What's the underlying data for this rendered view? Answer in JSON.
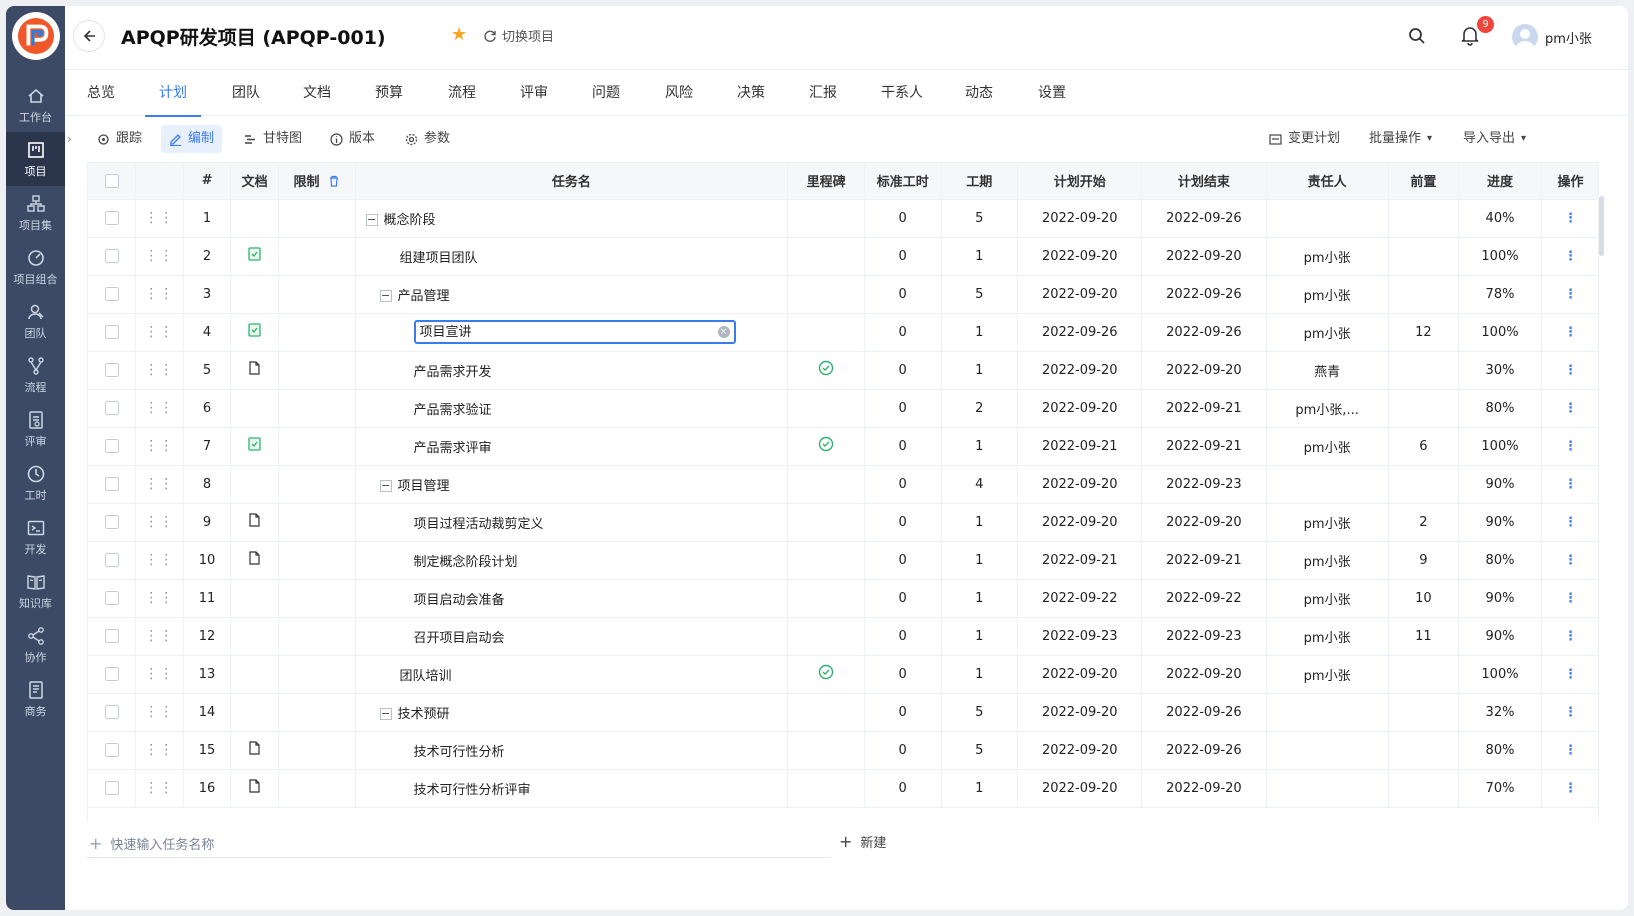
{
  "sidebar": {
    "items": [
      {
        "label": "工作台",
        "icon": "home-icon"
      },
      {
        "label": "项目",
        "icon": "project-icon"
      },
      {
        "label": "项目集",
        "icon": "program-icon"
      },
      {
        "label": "项目组合",
        "icon": "portfolio-icon"
      },
      {
        "label": "团队",
        "icon": "team-icon"
      },
      {
        "label": "流程",
        "icon": "flow-icon"
      },
      {
        "label": "评审",
        "icon": "review-icon"
      },
      {
        "label": "工时",
        "icon": "clock-icon"
      },
      {
        "label": "开发",
        "icon": "terminal-icon"
      },
      {
        "label": "知识库",
        "icon": "book-icon"
      },
      {
        "label": "协作",
        "icon": "share-icon"
      },
      {
        "label": "商务",
        "icon": "business-icon"
      }
    ],
    "active_index": 1
  },
  "header": {
    "title": "APQP研发项目 (APQP-001)",
    "switch_label": "切换项目",
    "notification_count": "9",
    "user": "pm小张"
  },
  "tabs": [
    "总览",
    "计划",
    "团队",
    "文档",
    "预算",
    "流程",
    "评审",
    "问题",
    "风险",
    "决策",
    "汇报",
    "干系人",
    "动态",
    "设置"
  ],
  "active_tab": 1,
  "toolbar": {
    "left": [
      "跟踪",
      "编制",
      "甘特图",
      "版本",
      "参数"
    ],
    "active": 1,
    "right": [
      "变更计划",
      "批量操作",
      "导入导出"
    ]
  },
  "table": {
    "columns": [
      "#",
      "文档",
      "限制",
      "任务名",
      "里程碑",
      "标准工时",
      "工期",
      "计划开始",
      "计划结束",
      "责任人",
      "前置",
      "进度",
      "操作"
    ],
    "rows": [
      {
        "no": "1",
        "doc": "",
        "task": "概念阶段",
        "level": 0,
        "toggle": true,
        "milestone": false,
        "std": "0",
        "dur": "5",
        "start": "2022-09-20",
        "end": "2022-09-26",
        "owner": "",
        "pre": "",
        "progress": "40%"
      },
      {
        "no": "2",
        "doc": "green",
        "task": "组建项目团队",
        "level": 1,
        "toggle": false,
        "milestone": false,
        "std": "0",
        "dur": "1",
        "start": "2022-09-20",
        "end": "2022-09-20",
        "owner": "pm小张",
        "pre": "",
        "progress": "100%"
      },
      {
        "no": "3",
        "doc": "",
        "task": "产品管理",
        "level": 1,
        "toggle": true,
        "milestone": false,
        "std": "0",
        "dur": "5",
        "start": "2022-09-20",
        "end": "2022-09-26",
        "owner": "pm小张",
        "pre": "",
        "progress": "78%"
      },
      {
        "no": "4",
        "doc": "green",
        "task": "项目宣讲",
        "level": 2,
        "toggle": false,
        "editing": true,
        "milestone": false,
        "std": "0",
        "dur": "1",
        "start": "2022-09-26",
        "end": "2022-09-26",
        "owner": "pm小张",
        "pre": "12",
        "progress": "100%"
      },
      {
        "no": "5",
        "doc": "file",
        "task": "产品需求开发",
        "level": 2,
        "toggle": false,
        "milestone": true,
        "std": "0",
        "dur": "1",
        "start": "2022-09-20",
        "end": "2022-09-20",
        "owner": "燕青",
        "pre": "",
        "progress": "30%"
      },
      {
        "no": "6",
        "doc": "",
        "task": "产品需求验证",
        "level": 2,
        "toggle": false,
        "milestone": false,
        "std": "0",
        "dur": "2",
        "start": "2022-09-20",
        "end": "2022-09-21",
        "owner": "pm小张,...",
        "pre": "",
        "progress": "80%"
      },
      {
        "no": "7",
        "doc": "green",
        "task": "产品需求评审",
        "level": 2,
        "toggle": false,
        "milestone": true,
        "std": "0",
        "dur": "1",
        "start": "2022-09-21",
        "end": "2022-09-21",
        "owner": "pm小张",
        "pre": "6",
        "progress": "100%"
      },
      {
        "no": "8",
        "doc": "",
        "task": "项目管理",
        "level": 1,
        "toggle": true,
        "milestone": false,
        "std": "0",
        "dur": "4",
        "start": "2022-09-20",
        "end": "2022-09-23",
        "owner": "",
        "pre": "",
        "progress": "90%"
      },
      {
        "no": "9",
        "doc": "file",
        "task": "项目过程活动裁剪定义",
        "level": 2,
        "toggle": false,
        "milestone": false,
        "std": "0",
        "dur": "1",
        "start": "2022-09-20",
        "end": "2022-09-20",
        "owner": "pm小张",
        "pre": "2",
        "progress": "90%"
      },
      {
        "no": "10",
        "doc": "file",
        "task": "制定概念阶段计划",
        "level": 2,
        "toggle": false,
        "milestone": false,
        "std": "0",
        "dur": "1",
        "start": "2022-09-21",
        "end": "2022-09-21",
        "owner": "pm小张",
        "pre": "9",
        "progress": "80%"
      },
      {
        "no": "11",
        "doc": "",
        "task": "项目启动会准备",
        "level": 2,
        "toggle": false,
        "milestone": false,
        "std": "0",
        "dur": "1",
        "start": "2022-09-22",
        "end": "2022-09-22",
        "owner": "pm小张",
        "pre": "10",
        "progress": "90%"
      },
      {
        "no": "12",
        "doc": "",
        "task": "召开项目启动会",
        "level": 2,
        "toggle": false,
        "milestone": false,
        "std": "0",
        "dur": "1",
        "start": "2022-09-23",
        "end": "2022-09-23",
        "owner": "pm小张",
        "pre": "11",
        "progress": "90%"
      },
      {
        "no": "13",
        "doc": "",
        "task": "团队培训",
        "level": 1,
        "toggle": false,
        "milestone": true,
        "std": "0",
        "dur": "1",
        "start": "2022-09-20",
        "end": "2022-09-20",
        "owner": "pm小张",
        "pre": "",
        "progress": "100%"
      },
      {
        "no": "14",
        "doc": "",
        "task": "技术预研",
        "level": 1,
        "toggle": true,
        "milestone": false,
        "std": "0",
        "dur": "5",
        "start": "2022-09-20",
        "end": "2022-09-26",
        "owner": "",
        "pre": "",
        "progress": "32%"
      },
      {
        "no": "15",
        "doc": "file",
        "task": "技术可行性分析",
        "level": 2,
        "toggle": false,
        "milestone": false,
        "std": "0",
        "dur": "5",
        "start": "2022-09-20",
        "end": "2022-09-26",
        "owner": "",
        "pre": "",
        "progress": "80%"
      },
      {
        "no": "16",
        "doc": "file",
        "task": "技术可行性分析评审",
        "level": 2,
        "toggle": false,
        "milestone": false,
        "std": "0",
        "dur": "1",
        "start": "2022-09-20",
        "end": "2022-09-20",
        "owner": "",
        "pre": "",
        "progress": "70%"
      }
    ]
  },
  "footer": {
    "quick_input_placeholder": "快速输入任务名称",
    "new_label": "新建"
  },
  "colors": {
    "accent": "#3a7bf0",
    "sidebar": "#3c4a66",
    "milestone": "#2fb36c",
    "badge": "#f0453a",
    "star": "#f5a623"
  }
}
